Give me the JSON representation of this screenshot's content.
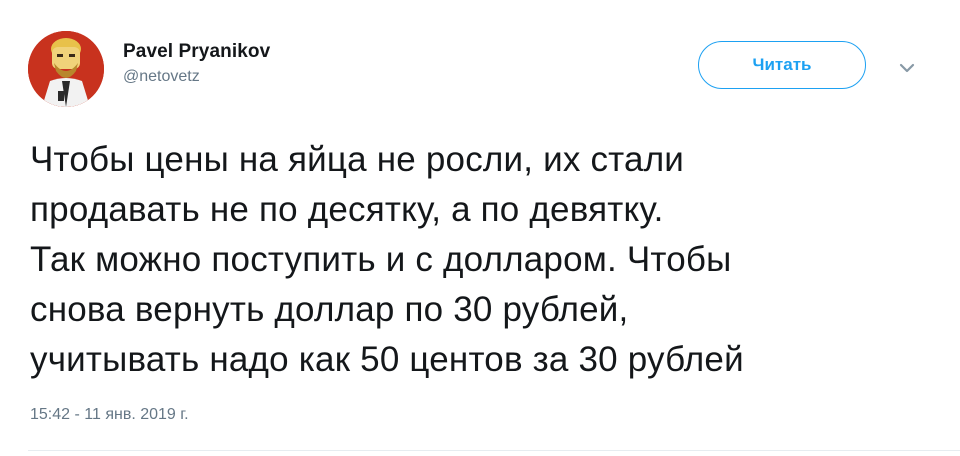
{
  "author": {
    "display_name": "Pavel Pryanikov",
    "handle": "@netovetz"
  },
  "follow_button": {
    "label": "Читать"
  },
  "tweet": {
    "lines": [
      "Чтобы цены на яйца не росли, их стали",
      "продавать не по десятку, а по девятку.",
      "Так можно поступить и с долларом. Чтобы",
      "снова вернуть доллар по 30 рублей,",
      "учитывать надо как 50 центов за 30 рублей"
    ],
    "timestamp": "15:42 - 11 янв. 2019 г."
  },
  "icons": {
    "avatar": "avatar-image",
    "caret": "chevron-down-icon"
  },
  "colors": {
    "accent": "#1da1f2",
    "secondary_text": "#657786",
    "primary_text": "#14171a",
    "avatar_background": "#c8321e"
  }
}
